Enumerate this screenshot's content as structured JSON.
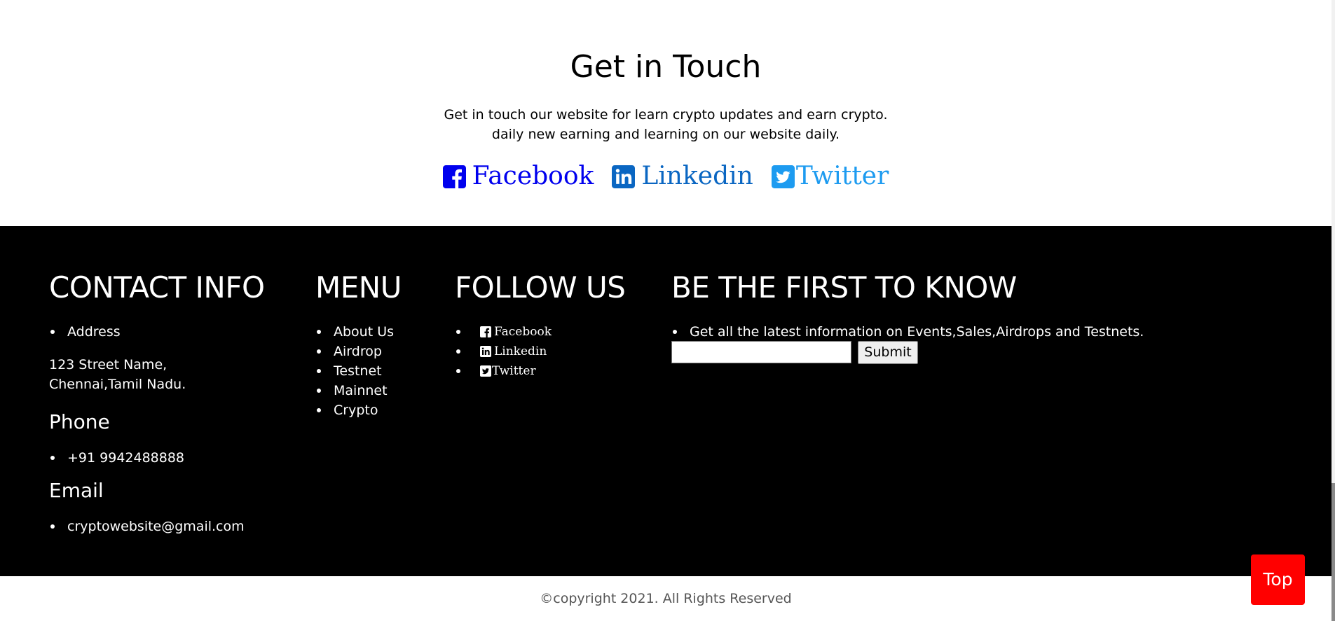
{
  "touch": {
    "title": "Get in Touch",
    "desc_line1": "Get in touch our website for learn crypto updates and earn crypto.",
    "desc_line2": "daily new earning and learning on our website daily.",
    "links": {
      "facebook": "Facebook",
      "linkedin": "Linkedin",
      "twitter": "Twitter"
    },
    "colors": {
      "facebook": "#0000ee",
      "linkedin": "#0a66c2",
      "twitter": "#1d9bf0"
    }
  },
  "footer": {
    "background": "#000000",
    "contact": {
      "heading": "CONTACT INFO",
      "address_label": "Address",
      "address_line1": "123 Street Name,",
      "address_line2": "Chennai,Tamil Nadu.",
      "phone_heading": "Phone",
      "phone": "+91 9942488888",
      "email_heading": "Email",
      "email": "cryptowebsite@gmail.com"
    },
    "menu": {
      "heading": "MENU",
      "items": [
        "About Us",
        "Airdrop",
        "Testnet",
        "Mainnet",
        "Crypto"
      ]
    },
    "follow": {
      "heading": "FOLLOW US",
      "items": [
        {
          "label": "Facebook",
          "icon": "facebook-icon"
        },
        {
          "label": "Linkedin",
          "icon": "linkedin-icon"
        },
        {
          "label": "Twitter",
          "icon": "twitter-icon"
        }
      ]
    },
    "newsletter": {
      "heading": "BE THE FIRST TO KNOW",
      "text": "Get all the latest information on Events,Sales,Airdrops and Testnets.",
      "input_value": "",
      "submit_label": "Submit"
    }
  },
  "copyright": "©copyright 2021. All Rights Reserved",
  "top_button": {
    "label": "Top",
    "color": "#ff0000"
  }
}
